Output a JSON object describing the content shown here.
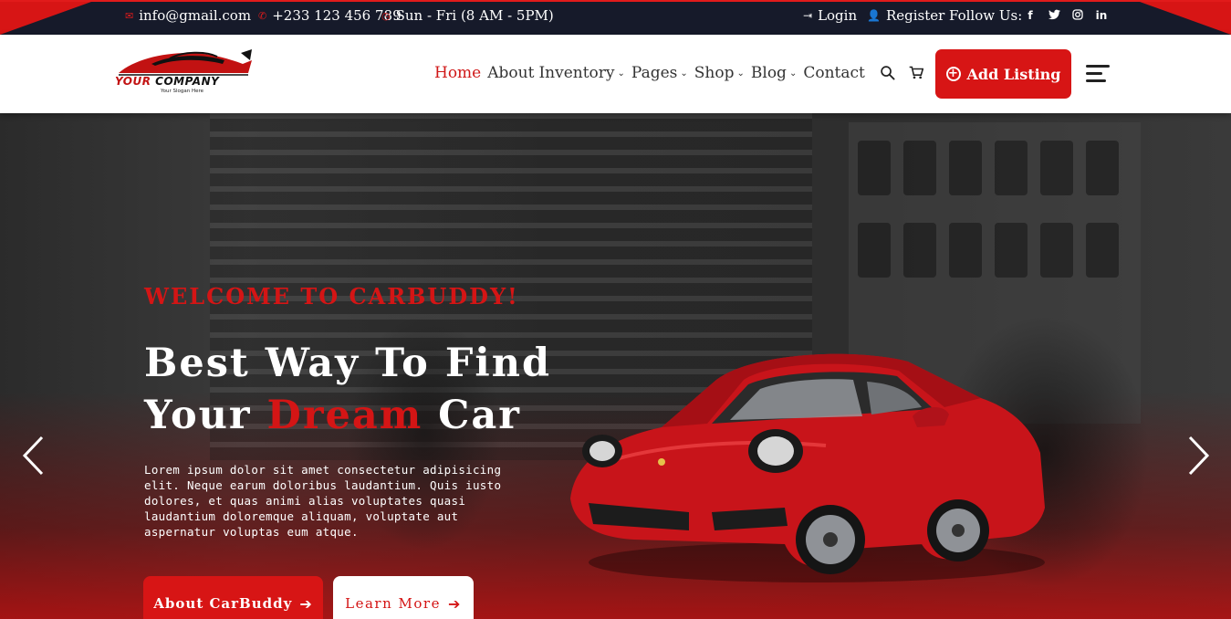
{
  "topbar": {
    "email": "info@gmail.com",
    "phone": "+233 123 456 789",
    "hours": "Sun - Fri (8 AM - 5PM)",
    "login": "Login",
    "register": "Register",
    "follow": "Follow Us:",
    "socials": [
      {
        "icon": "facebook-icon",
        "glyph": "f"
      },
      {
        "icon": "twitter-icon",
        "glyph": "🐦"
      },
      {
        "icon": "instagram-icon",
        "glyph": "◎"
      },
      {
        "icon": "linkedin-icon",
        "glyph": "in"
      }
    ],
    "accent": "#d71515"
  },
  "header": {
    "logo": {
      "word_a": "YOUR",
      "word_b": "COMPANY",
      "slogan": "Your Slogan Here"
    },
    "nav": [
      {
        "label": "Home",
        "active": true,
        "dropdown": false
      },
      {
        "label": "About",
        "active": false,
        "dropdown": false
      },
      {
        "label": "Inventory",
        "active": false,
        "dropdown": true
      },
      {
        "label": "Pages",
        "active": false,
        "dropdown": true
      },
      {
        "label": "Shop",
        "active": false,
        "dropdown": true
      },
      {
        "label": "Blog",
        "active": false,
        "dropdown": true
      },
      {
        "label": "Contact",
        "active": false,
        "dropdown": false
      }
    ],
    "add_listing": "Add Listing"
  },
  "hero": {
    "welcome": "WELCOME TO CARBUDDY!",
    "title_line1": "Best Way To Find",
    "title_line2_a": "Your ",
    "title_line2_red": "Dream",
    "title_line2_b": " Car",
    "description": "Lorem ipsum dolor sit amet consectetur adipisicing elit. Neque earum doloribus laudantium. Quis iusto dolores, et quas animi alias voluptates quasi laudantium doloremque aliquam, voluptate aut aspernatur voluptas eum atque.",
    "btn_about": "About CarBuddy",
    "btn_learn": "Learn More"
  },
  "colors": {
    "brand_red": "#d71515",
    "topbar_bg": "#161a2a"
  }
}
